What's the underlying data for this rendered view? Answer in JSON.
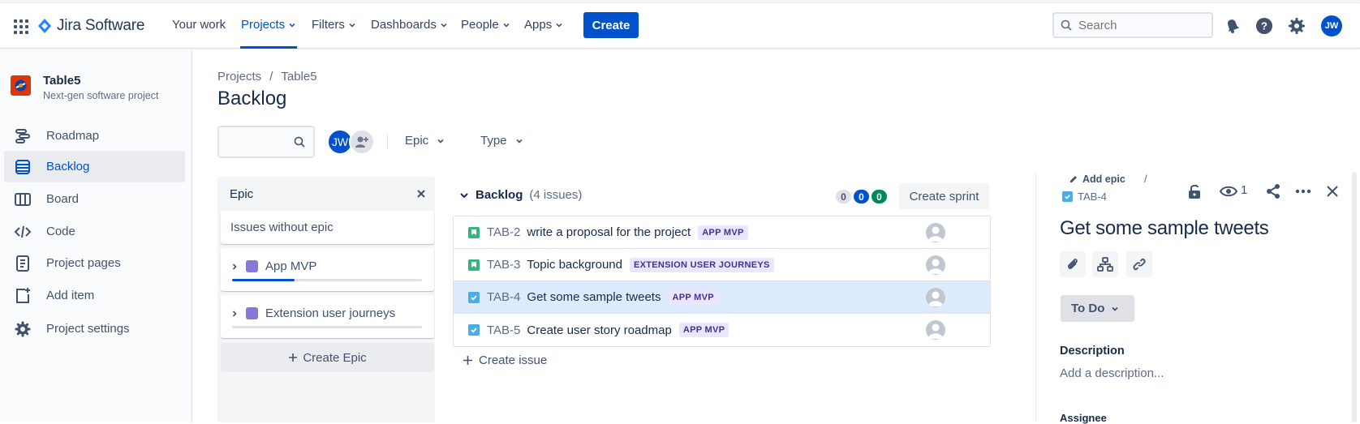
{
  "nav": {
    "logo_text": "Jira Software",
    "items": [
      {
        "label": "Your work"
      },
      {
        "label": "Projects"
      },
      {
        "label": "Filters"
      },
      {
        "label": "Dashboards"
      },
      {
        "label": "People"
      },
      {
        "label": "Apps"
      }
    ],
    "create_label": "Create",
    "search_placeholder": "Search",
    "user_initials": "JW",
    "accent": "#0052cc"
  },
  "sidebar": {
    "project_name": "Table5",
    "project_type": "Next-gen software project",
    "items": [
      {
        "label": "Roadmap",
        "icon": "roadmap-icon"
      },
      {
        "label": "Backlog",
        "icon": "backlog-icon",
        "active": true
      },
      {
        "label": "Board",
        "icon": "board-icon"
      },
      {
        "label": "Code",
        "icon": "code-icon"
      },
      {
        "label": "Project pages",
        "icon": "pages-icon"
      },
      {
        "label": "Add item",
        "icon": "add-item-icon"
      },
      {
        "label": "Project settings",
        "icon": "gear-icon"
      }
    ]
  },
  "main": {
    "breadcrumb": [
      "Projects",
      "/",
      "Table5"
    ],
    "title": "Backlog",
    "filter_avatar": "JW",
    "filters": [
      {
        "label": "Epic"
      },
      {
        "label": "Type"
      }
    ]
  },
  "epic_panel": {
    "title": "Epic",
    "no_epic_label": "Issues without epic",
    "epics": [
      {
        "label": "App MVP",
        "progress": 0.33,
        "color": "#8777d9"
      },
      {
        "label": "Extension user journeys",
        "progress": 0,
        "color": "#8777d9"
      }
    ],
    "create_label": "Create Epic"
  },
  "backlog": {
    "name": "Backlog",
    "count_text": "(4 issues)",
    "counts": [
      {
        "value": "0",
        "bg": "#dfe1e6",
        "fg": "#42526e"
      },
      {
        "value": "0",
        "bg": "#0052cc",
        "fg": "#ffffff"
      },
      {
        "value": "0",
        "bg": "#00875a",
        "fg": "#ffffff"
      }
    ],
    "create_sprint_label": "Create sprint",
    "issues": [
      {
        "key": "TAB-2",
        "summary": "write a proposal for the project",
        "label": "APP MVP",
        "type": "story"
      },
      {
        "key": "TAB-3",
        "summary": "Topic background",
        "label": "EXTENSION USER JOURNEYS",
        "type": "story"
      },
      {
        "key": "TAB-4",
        "summary": "Get some sample tweets",
        "label": "APP MVP",
        "type": "task",
        "selected": true
      },
      {
        "key": "TAB-5",
        "summary": "Create user story roadmap",
        "label": "APP MVP",
        "type": "task"
      }
    ],
    "create_issue_label": "Create issue"
  },
  "detail": {
    "add_epic_label": "Add epic",
    "separator": "/",
    "issue_key": "TAB-4",
    "watch_count": "1",
    "title": "Get some sample tweets",
    "status": "To Do",
    "description_label": "Description",
    "description_placeholder": "Add a description...",
    "assignee_label": "Assignee"
  }
}
